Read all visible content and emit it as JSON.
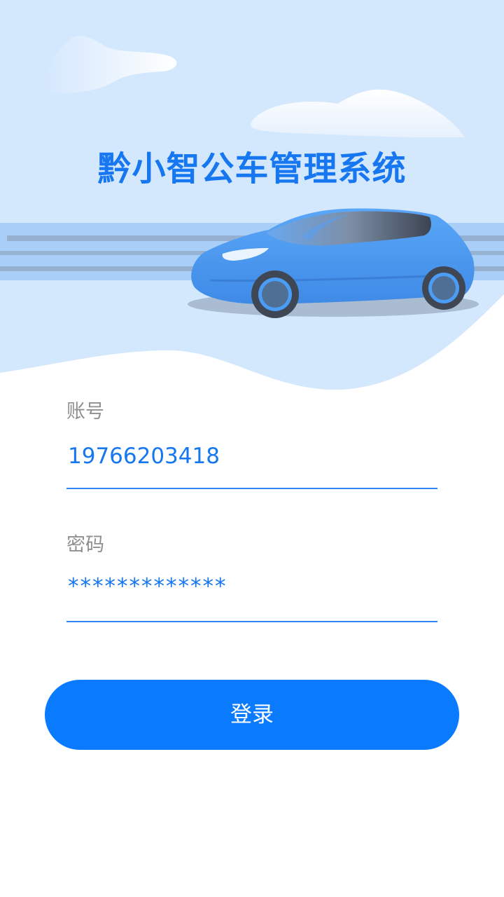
{
  "app": {
    "title": "黔小智公车管理系统"
  },
  "hero": {
    "illustration": "car-illustration",
    "colors": {
      "sky": "#d3e7fd",
      "car_body": "#4b9cf5",
      "road": "#a9cff8"
    }
  },
  "form": {
    "account": {
      "label": "账号",
      "value": "19766203418"
    },
    "password": {
      "label": "密码",
      "value": "*************"
    },
    "login_label": "登录"
  },
  "colors": {
    "accent": "#1677f0",
    "button": "#0a7aff",
    "label": "#8f8f8f"
  }
}
